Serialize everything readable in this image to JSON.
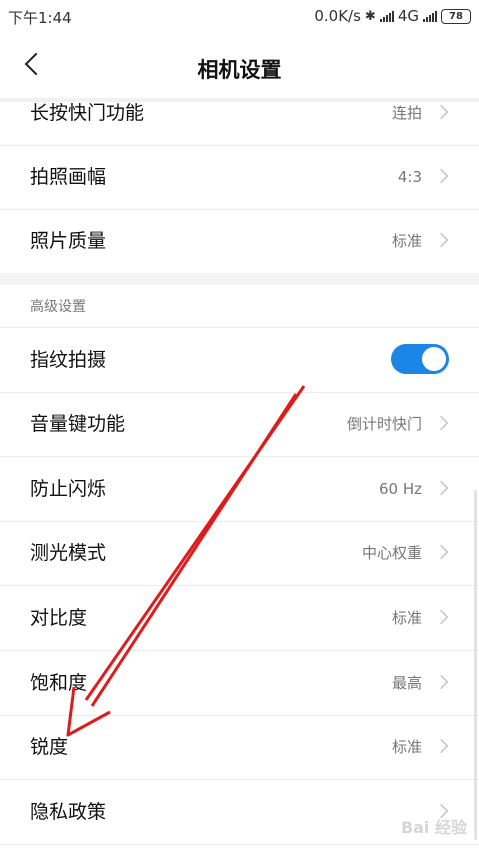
{
  "status_bar": {
    "time": "下午1:44",
    "network_speed": "0.0K/s",
    "network_type": "4G",
    "battery": "78",
    "icons": [
      "bluetooth-icon",
      "signal-icon",
      "signal-icon",
      "battery-icon"
    ]
  },
  "header": {
    "back_icon": "chevron-left-icon",
    "title": "相机设置"
  },
  "settings_top": [
    {
      "label": "长按快门功能",
      "value": "连拍"
    },
    {
      "label": "拍照画幅",
      "value": "4:3"
    },
    {
      "label": "照片质量",
      "value": "标准"
    }
  ],
  "advanced": {
    "section_title": "高级设置",
    "fingerprint": {
      "label": "指纹拍摄",
      "enabled": true
    },
    "items": [
      {
        "label": "音量键功能",
        "value": "倒计时快门"
      },
      {
        "label": "防止闪烁",
        "value": "60 Hz"
      },
      {
        "label": "测光模式",
        "value": "中心权重"
      },
      {
        "label": "对比度",
        "value": "标准"
      },
      {
        "label": "饱和度",
        "value": "最高"
      },
      {
        "label": "锐度",
        "value": "标准"
      },
      {
        "label": "隐私政策",
        "value": ""
      }
    ]
  },
  "annotation": {
    "arrow_color": "#e01b1b"
  },
  "watermark": "Bai 经验",
  "colors": {
    "toggle_on": "#1c86e6",
    "text_secondary": "#777777",
    "separator": "#ececec"
  }
}
